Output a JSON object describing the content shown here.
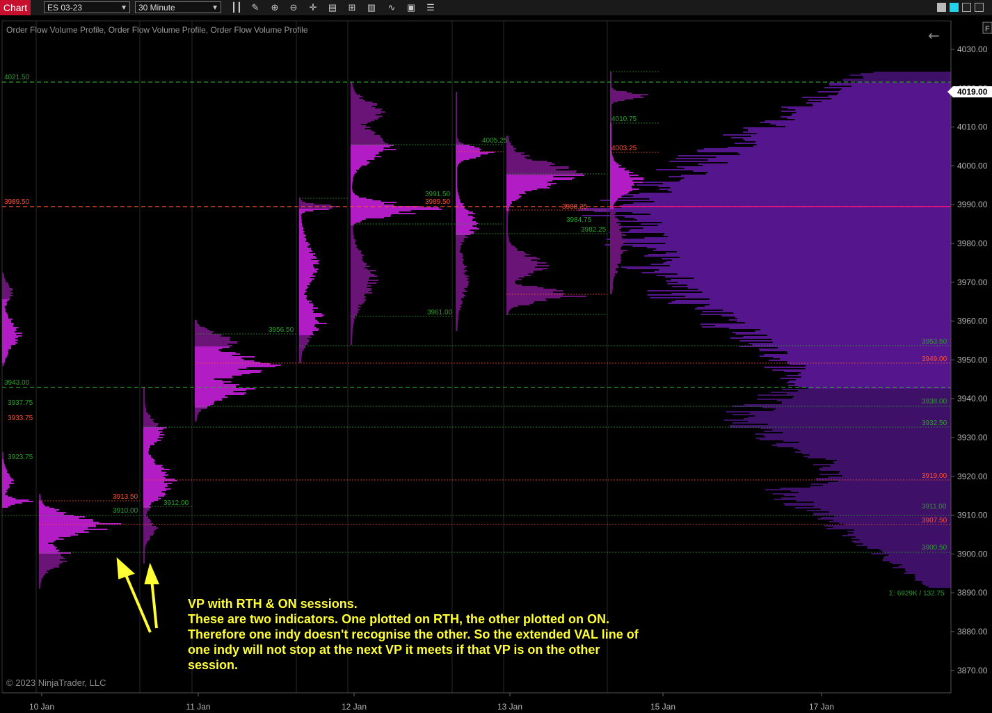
{
  "toolbar": {
    "tab_label": "Chart",
    "instrument": "ES 03-23",
    "interval": "30 Minute",
    "icons": [
      "bar-type-icon",
      "draw-pencil-icon",
      "zoom-in-icon",
      "zoom-out-icon",
      "crosshair-icon",
      "data-box-icon",
      "properties-icon",
      "indicators-icon",
      "strategies-icon",
      "templates-icon",
      "menu-icon"
    ],
    "right_tab": "F"
  },
  "chart": {
    "indicator_title": "Order Flow Volume Profile, Order Flow Volume Profile, Order Flow Volume Profile",
    "copyright": "© 2023 NinjaTrader, LLC",
    "last_price": "4019.00",
    "summary": "Σ: 6929K / 132.75",
    "price_ticks": [
      "4030.00",
      "4020.00",
      "4010.00",
      "4000.00",
      "3990.00",
      "3980.00",
      "3970.00",
      "3960.00",
      "3950.00",
      "3940.00",
      "3930.00",
      "3920.00",
      "3910.00",
      "3900.00",
      "3890.00",
      "3880.00",
      "3870.00"
    ],
    "date_labels": [
      "10 Jan",
      "11 Jan",
      "12 Jan",
      "13 Jan",
      "15 Jan",
      "17 Jan"
    ],
    "level_labels": [
      {
        "text": "4021.50",
        "color": "#2aa02a"
      },
      {
        "text": "3989.50",
        "color": "#ff5030"
      },
      {
        "text": "3943.00",
        "color": "#2aa02a"
      },
      {
        "text": "3937.75",
        "color": "#2aa02a"
      },
      {
        "text": "3933.75",
        "color": "#ff5030"
      },
      {
        "text": "3923.75",
        "color": "#2aa02a"
      },
      {
        "text": "3913.50",
        "color": "#ff5030"
      },
      {
        "text": "3910.00",
        "color": "#2aa02a"
      },
      {
        "text": "3912.00",
        "color": "#2aa02a"
      },
      {
        "text": "3956.50",
        "color": "#2aa02a"
      },
      {
        "text": "3991.50",
        "color": "#2aa02a"
      },
      {
        "text": "3989.50",
        "color": "#ff5030"
      },
      {
        "text": "3961.00",
        "color": "#2aa02a"
      },
      {
        "text": "4005.25",
        "color": "#2aa02a"
      },
      {
        "text": "3988.25",
        "color": "#ff5030"
      },
      {
        "text": "3984.75",
        "color": "#2aa02a"
      },
      {
        "text": "3982.25",
        "color": "#2aa02a"
      },
      {
        "text": "4010.75",
        "color": "#2aa02a"
      },
      {
        "text": "4003.25",
        "color": "#ff5030"
      },
      {
        "text": "3953.50",
        "color": "#2aa02a"
      },
      {
        "text": "3949.00",
        "color": "#ff5030"
      },
      {
        "text": "3938.00",
        "color": "#2aa02a"
      },
      {
        "text": "3932.50",
        "color": "#2aa02a"
      },
      {
        "text": "3919.00",
        "color": "#ff5030"
      },
      {
        "text": "3911.00",
        "color": "#2aa02a"
      },
      {
        "text": "3907.50",
        "color": "#ff5030"
      },
      {
        "text": "3900.50",
        "color": "#2aa02a"
      }
    ],
    "colors": {
      "vah_val": "#2aa02a",
      "poc": "#ff5030",
      "profile": "#b020c0",
      "composite": "#5a1590",
      "background": "#000000"
    }
  },
  "annotation": {
    "lines": [
      "VP with RTH & ON sessions.",
      "These are two indicators. One plotted on RTH, the other plotted on ON.",
      "Therefore one indy doesn't recognise the other. So the extended VAL line of",
      "one indy will not stop at the next VP it meets if that VP is on the other",
      "session."
    ]
  }
}
